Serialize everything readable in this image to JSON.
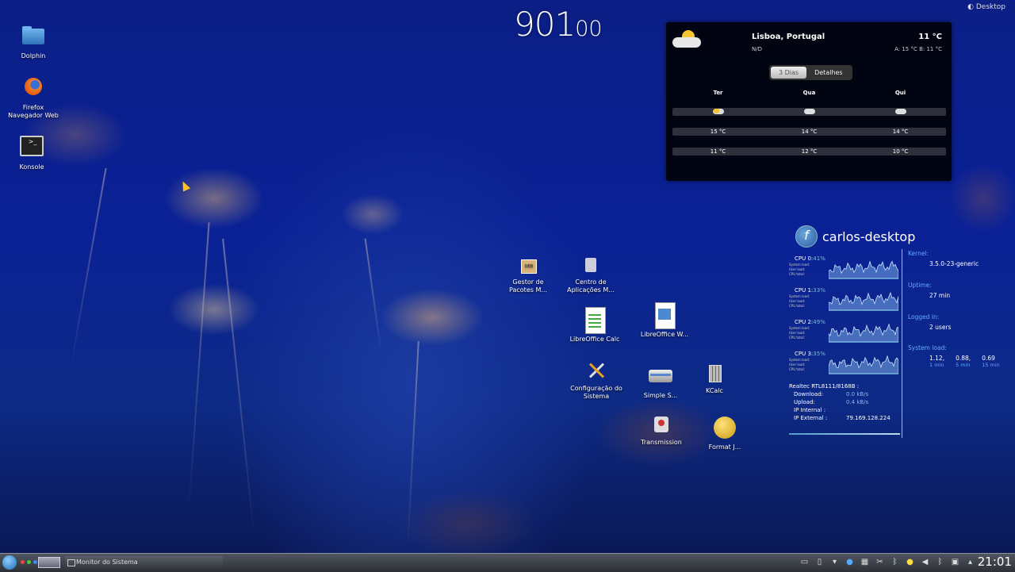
{
  "desktop": {
    "top_right_label": "Desktop",
    "left_icons": [
      {
        "icon": "folder-icon",
        "label": "Dolphin"
      },
      {
        "icon": "firefox-icon",
        "label": "Firefox\nNavegador Web"
      },
      {
        "icon": "terminal-icon",
        "label": "Konsole"
      }
    ],
    "middle_icons": [
      {
        "icon": "package-manager-icon",
        "label": "Gestor de Pacotes M..."
      },
      {
        "icon": "app-center-icon",
        "label": "Centro de Aplicações M..."
      },
      {
        "icon": "spreadsheet-icon",
        "label": "LibreOffice Calc"
      },
      {
        "icon": "writer-document-icon",
        "label": "LibreOffice W..."
      },
      {
        "icon": "wrench-icon",
        "label": "Configuração do Sistema"
      },
      {
        "icon": "scanner-icon",
        "label": "Simple S..."
      },
      {
        "icon": "calculator-icon",
        "label": "KCalc"
      },
      {
        "icon": "transmission-icon",
        "label": "Transmission"
      },
      {
        "icon": "format-drive-icon",
        "label": "Format J..."
      }
    ]
  },
  "clock": {
    "hours": "9",
    "hours_rest": "0",
    "minutes": "1",
    "small": "00"
  },
  "weather": {
    "location": "Lisboa, Portugal",
    "condition": "N/D",
    "temperature": "11 °C",
    "high_low": "A: 15 °C B: 11 °C",
    "tabs": [
      "3 Dias",
      "Detalhes"
    ],
    "days": [
      "Ter",
      "Qua",
      "Qui"
    ],
    "highs": [
      "15 °C",
      "14 °C",
      "14 °C"
    ],
    "lows": [
      "11 °C",
      "12 °C",
      "10 °C"
    ]
  },
  "system": {
    "hostname": "carlos-desktop",
    "cpus": [
      {
        "label": "CPU 0:",
        "value": "41%"
      },
      {
        "label": "CPU 1:",
        "value": "33%"
      },
      {
        "label": "CPU 2:",
        "value": "49%"
      },
      {
        "label": "CPU 3:",
        "value": "35%"
      }
    ],
    "cpu_sub": [
      "System load:",
      "User load:",
      "CPU total:"
    ],
    "network": {
      "adapter": "Realtec RTL8111/8168B :",
      "download_label": "Download:",
      "download": "0.0 kB/s",
      "upload_label": "Upload:",
      "upload": "0.4 kB/s",
      "internal_label": "IP Internal :",
      "internal": "",
      "external_label": "IP External :",
      "external": "79.169.128.224"
    },
    "kernel_label": "Kernel:",
    "kernel": "3.5.0-23-generic",
    "uptime_label": "Uptime:",
    "uptime": "27 min",
    "logged_label": "Logged in:",
    "logged": "2 users",
    "load_label": "System load:",
    "loads": [
      "1.12,",
      "0.88,",
      "0.69"
    ],
    "load_periods": [
      "1 min",
      "5 min",
      "15 min"
    ]
  },
  "taskbar": {
    "task": "Monitor do Sistema",
    "time": "21:01"
  }
}
